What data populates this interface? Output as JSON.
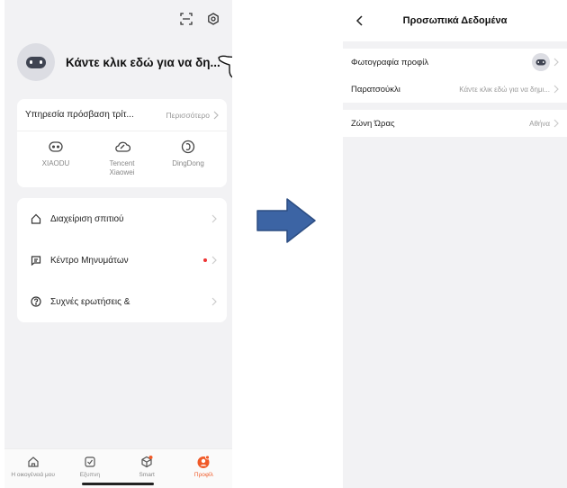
{
  "left": {
    "profile": {
      "name": "Κάντε κλικ εδώ για να δη..."
    },
    "services": {
      "title": "Υπηρεσία πρόσβαση τρίτ...",
      "more": "Περισσότερο",
      "items": [
        {
          "label": "XIAODU",
          "icon": "xiaodu-icon"
        },
        {
          "label": "Tencent\nXiaowei",
          "icon": "tencent-xiaowei-icon"
        },
        {
          "label": "DingDong",
          "icon": "dingdong-icon"
        }
      ]
    },
    "menu": [
      {
        "label": "Διαχείριση σπιτιού",
        "icon": "home-outline-icon"
      },
      {
        "label": "Κέντρο Μηνυμάτων",
        "icon": "message-icon"
      },
      {
        "label": "Συχνές ερωτήσεις &",
        "icon": "help-icon"
      }
    ],
    "tabs": [
      {
        "label": "Η οικογένειά μου",
        "icon": "home-tab-icon",
        "active": false
      },
      {
        "label": "Εξυπνη",
        "icon": "smart-scene-icon",
        "active": false
      },
      {
        "label": "Smart",
        "icon": "smart-cube-icon",
        "active": false
      },
      {
        "label": "Προφίλ",
        "icon": "profile-icon",
        "active": true
      }
    ]
  },
  "right": {
    "title": "Προσωπικά Δεδομένα",
    "rows": [
      {
        "label": "Φωτογραφία προφίλ",
        "value": ""
      },
      {
        "label": "Παρατσούκλι",
        "value": "Κάντε κλικ εδώ για να δημι..."
      }
    ],
    "timezone": {
      "label": "Ζώνη Ώρας",
      "value": "Αθήνα"
    }
  },
  "colors": {
    "accent": "#f05a28",
    "arrow": "#3c64a4",
    "background": "#f2f2f4",
    "notification_dot": "#e33333"
  }
}
